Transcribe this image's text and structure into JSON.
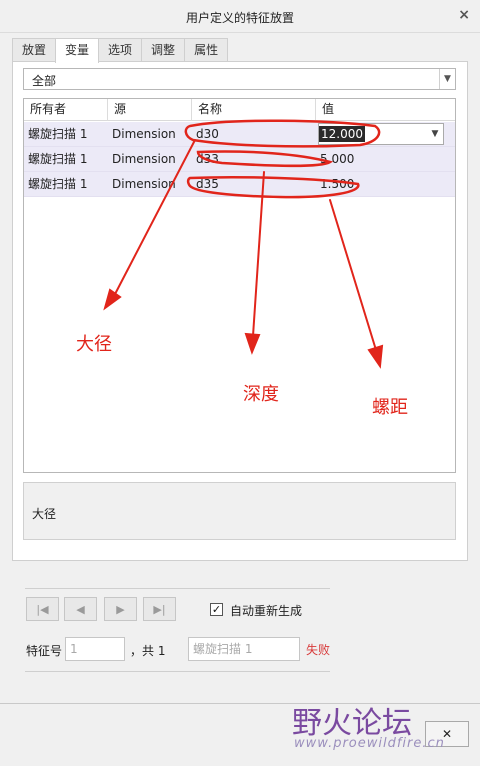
{
  "window": {
    "title": "用户定义的特征放置",
    "close_symbol": "×"
  },
  "tabs": [
    {
      "label": "放置",
      "active": false
    },
    {
      "label": "变量",
      "active": true
    },
    {
      "label": "选项",
      "active": false
    },
    {
      "label": "调整",
      "active": false
    },
    {
      "label": "属性",
      "active": false
    }
  ],
  "filter": {
    "selected": "全部"
  },
  "table": {
    "columns": [
      "所有者",
      "源",
      "名称",
      "值"
    ],
    "rows": [
      {
        "owner": "螺旋扫描 1",
        "source": "Dimension",
        "name": "d30",
        "value": "12.000"
      },
      {
        "owner": "螺旋扫描 1",
        "source": "Dimension",
        "name": "d33",
        "value": "5.000"
      },
      {
        "owner": "螺旋扫描 1",
        "source": "Dimension",
        "name": "d35",
        "value": "1.500"
      }
    ]
  },
  "description": {
    "text": "大径"
  },
  "navigation": {
    "first": "|◀",
    "prev": "◀",
    "next": "▶",
    "last": "▶|"
  },
  "regenerate": {
    "label": "自动重新生成",
    "checked": true,
    "check_mark": "✓"
  },
  "feature": {
    "number_label": "特征号",
    "number_value": "1",
    "total_label": "，共 1",
    "name_value": "螺旋扫描 1",
    "status": "失败"
  },
  "annotations": {
    "major_diameter": "大径",
    "depth": "深度",
    "pitch": "螺距"
  },
  "watermark": {
    "text": "野火论坛",
    "url": "www.proewildfire.cn"
  },
  "footer": {
    "button_label": "✕"
  },
  "colors": {
    "annotation": "#e1251b",
    "fail": "#d83b3b",
    "row_bg": "#eceaf7",
    "watermark": "#7a4aa0"
  }
}
